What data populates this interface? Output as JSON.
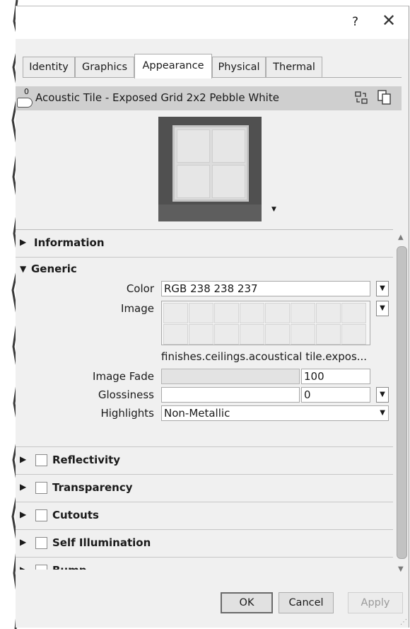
{
  "titlebar": {
    "help": "?",
    "close": "✕"
  },
  "tabs": [
    "Identity",
    "Graphics",
    "Appearance",
    "Physical",
    "Thermal"
  ],
  "active_tab": "Appearance",
  "asset": {
    "user_count": "0",
    "name": "Acoustic Tile - Exposed Grid 2x2 Pebble White"
  },
  "sections": {
    "information": "Information",
    "generic": "Generic",
    "reflectivity": "Reflectivity",
    "transparency": "Transparency",
    "cutouts": "Cutouts",
    "self_illumination": "Self Illumination",
    "bump": "Bump"
  },
  "generic": {
    "color_label": "Color",
    "color_value": "RGB 238 238 237",
    "image_label": "Image",
    "image_name": "finishes.ceilings.acoustical tile.expos...",
    "image_fade_label": "Image Fade",
    "image_fade_value": "100",
    "glossiness_label": "Glossiness",
    "glossiness_value": "0",
    "highlights_label": "Highlights",
    "highlights_value": "Non-Metallic"
  },
  "buttons": {
    "ok": "OK",
    "cancel": "Cancel",
    "apply": "Apply"
  },
  "colors": {
    "window_bg": "#f0f0f0",
    "header_bg": "#cfcfcf",
    "preview_bg": "#505050"
  }
}
